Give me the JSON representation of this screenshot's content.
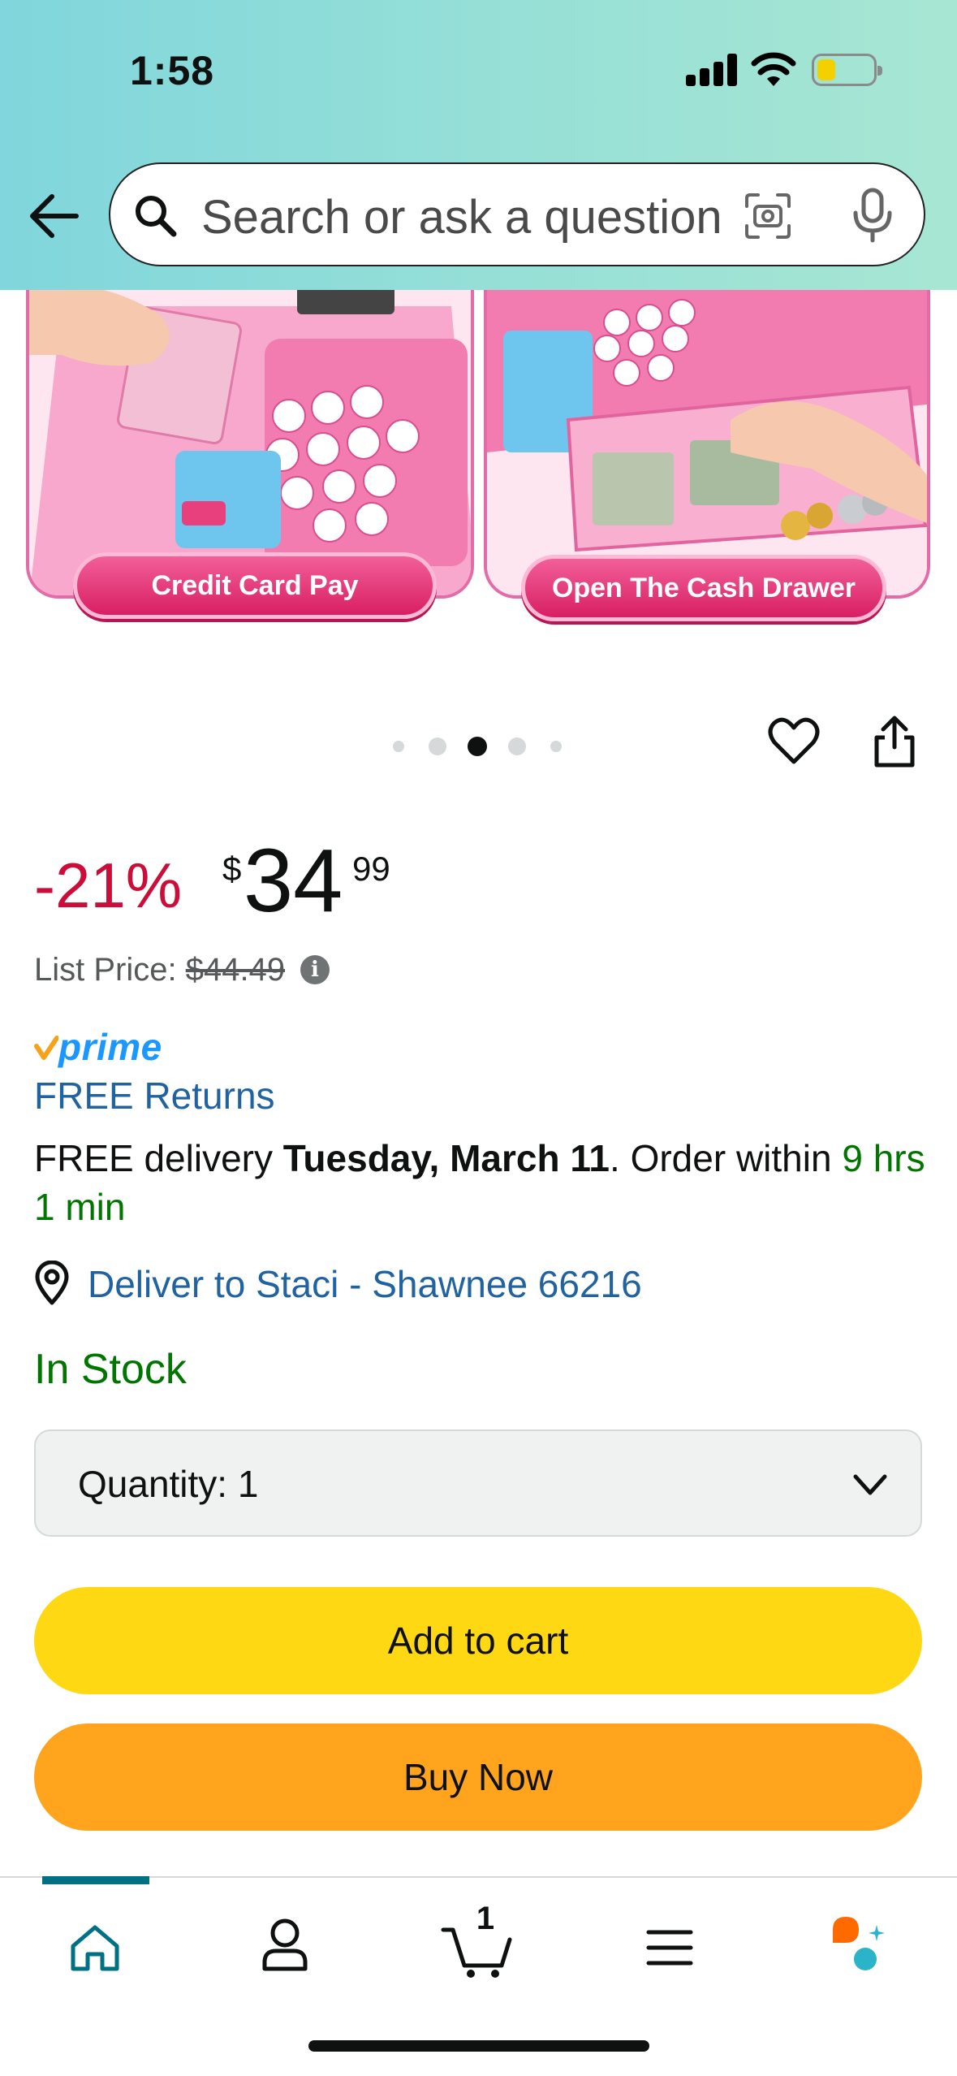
{
  "status_bar": {
    "time": "1:58"
  },
  "search": {
    "placeholder": "Search or ask a question"
  },
  "gallery": {
    "left_caption": "Credit Card Pay",
    "right_caption": "Open The Cash Drawer",
    "dot_count": 5,
    "active_dot": 3
  },
  "price": {
    "discount": "-21%",
    "symbol": "$",
    "whole": "34",
    "fraction": "99",
    "list_label": "List Price:",
    "list_value": "$44.49"
  },
  "prime": {
    "label": "prime"
  },
  "free_returns": "FREE Returns",
  "delivery": {
    "prefix": "FREE delivery ",
    "date": "Tuesday, March 11",
    "middle": ". Order within ",
    "countdown": "9 hrs 1 min"
  },
  "deliver_to": "Deliver to Staci - Shawnee 66216",
  "stock_status": "In Stock",
  "quantity": {
    "label": "Quantity:",
    "value": "1"
  },
  "buttons": {
    "add_to_cart": "Add to cart",
    "buy_now": "Buy Now"
  },
  "tabbar": {
    "cart_count": "1",
    "active_tab": "home"
  },
  "colors": {
    "deal_red": "#cc0c39",
    "link_blue": "#2162a1",
    "stock_green": "#007600",
    "add_to_cart_yellow": "#ffd814",
    "buy_now_orange": "#ffa41c",
    "tab_active": "#007185"
  }
}
